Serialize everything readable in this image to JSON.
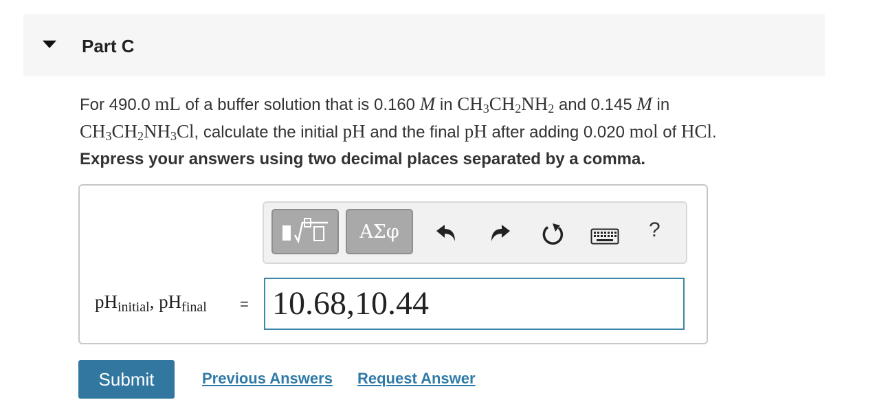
{
  "part": {
    "title": "Part C"
  },
  "question": {
    "t1": "For 490.0 ",
    "v1": "mL",
    "t2": " of a buffer solution that is 0.160 ",
    "m1": "M",
    "t3": " in ",
    "f1a": "CH",
    "f1a_sub": "3",
    "f1b": "CH",
    "f1b_sub": "2",
    "f1c": "NH",
    "f1c_sub": "2",
    "t4": " and 0.145 ",
    "m2": "M",
    "t5": " in",
    "f2a": "CH",
    "f2a_sub": "3",
    "f2b": "CH",
    "f2b_sub": "2",
    "f2c": "NH",
    "f2c_sub": "3",
    "f2d": "Cl",
    "t6": ", calculate the initial ",
    "v2": "pH",
    "t7": " and the final ",
    "v3": "pH",
    "t8": " after adding 0.020 ",
    "v4": "mol",
    "t9": " of ",
    "v5": "HCl",
    "t10": "."
  },
  "instruction": "Express your answers using two decimal places separated by a comma.",
  "toolbar": {
    "symbols_label": "ΑΣφ",
    "help_label": "?",
    "icons": [
      "templates-icon",
      "undo-icon",
      "redo-icon",
      "reset-icon",
      "keyboard-icon",
      "help-icon"
    ]
  },
  "answer": {
    "label_ph1": "pH",
    "label_sub1": "initial",
    "label_sep": ", ",
    "label_ph2": "pH",
    "label_sub2": "final",
    "equals": "=",
    "value": "10.68,10.44"
  },
  "actions": {
    "submit": "Submit",
    "previous": "Previous Answers",
    "request": "Request Answer"
  },
  "colors": {
    "submit_bg": "#3277a0",
    "link": "#2f7aa6",
    "input_border": "#3a87a8"
  }
}
